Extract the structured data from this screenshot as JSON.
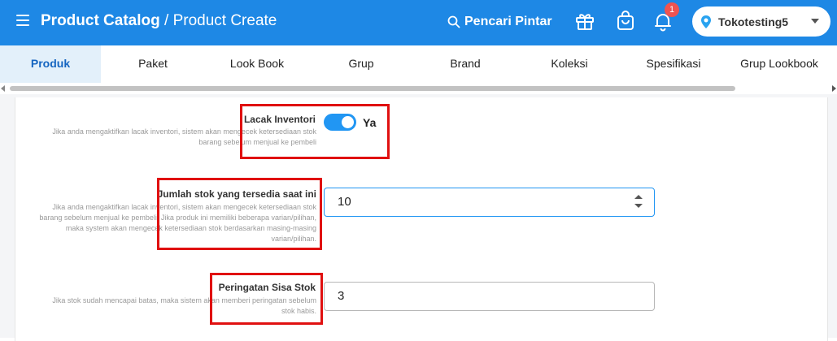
{
  "header": {
    "title_bold": "Product Catalog",
    "title_rest": "/ Product Create",
    "search_label": "Pencari Pintar",
    "notification_count": "1",
    "store_name": "Tokotesting5"
  },
  "tabs": [
    {
      "label": "Produk",
      "active": true
    },
    {
      "label": "Paket"
    },
    {
      "label": "Look Book"
    },
    {
      "label": "Grup"
    },
    {
      "label": "Brand"
    },
    {
      "label": "Koleksi"
    },
    {
      "label": "Spesifikasi"
    },
    {
      "label": "Grup Lookbook"
    }
  ],
  "form": {
    "lacak_inventori": {
      "label": "Lacak Inventori",
      "description": "Jika anda mengaktifkan lacak inventori, sistem akan mengecek ketersediaan stok barang sebelum menjual ke pembeli",
      "toggle_text": "Ya",
      "enabled": true
    },
    "jumlah_stok": {
      "label": "Jumlah stok yang tersedia saat ini",
      "description": "Jika anda mengaktifkan lacak inventori, sistem akan mengecek ketersediaan stok barang sebelum menjual ke pembeli. Jika produk ini memiliki beberapa varian/pilihan, maka system akan mengecek ketersediaan stok berdasarkan masing-masing varian/pilihan.",
      "value": "10"
    },
    "peringatan_sisa_stok": {
      "label": "Peringatan Sisa Stok",
      "description": "Jika stok sudah mencapai batas, maka sistem akan memberi peringatan sebelum stok habis.",
      "value": "3"
    }
  },
  "colors": {
    "header_bg": "#1e88e5",
    "active_tab_bg": "#e3f0fa",
    "toggle_on": "#2196f3",
    "highlight": "#e01010",
    "badge": "#ef5350"
  }
}
